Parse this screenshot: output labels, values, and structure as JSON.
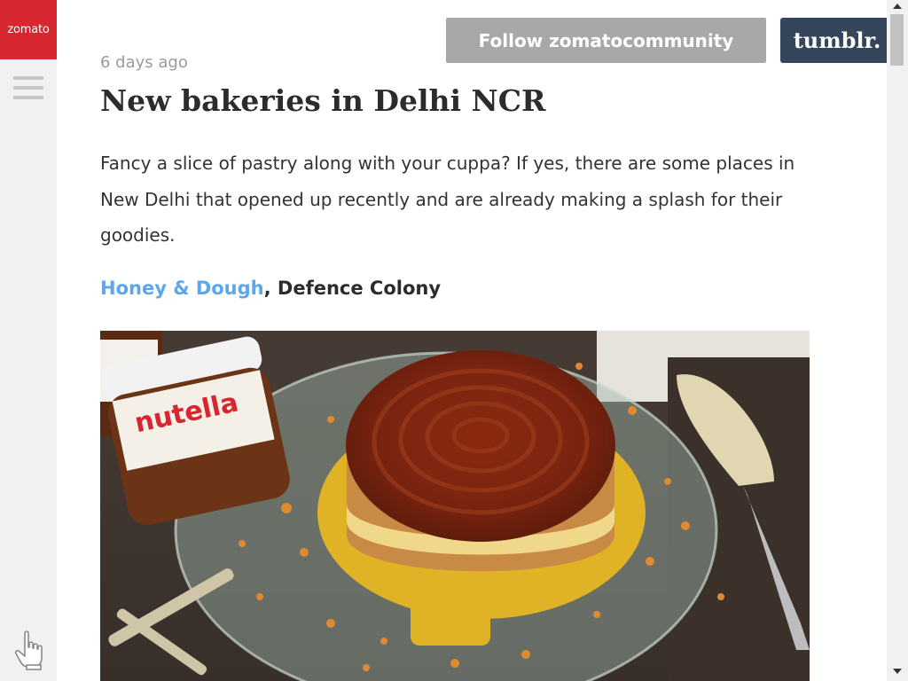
{
  "sidebar": {
    "logo_text": "zomato",
    "logo_color": "#d7262f",
    "menu_icon": "hamburger-menu-icon",
    "pointer_icon": "hand-pointer-icon"
  },
  "header": {
    "follow_label": "Follow zomatocommunity",
    "tumblr_label": "tumblr."
  },
  "post": {
    "timestamp": "6 days ago",
    "title": "New bakeries in Delhi NCR",
    "intro": "Fancy a slice of pastry along with your cuppa? If yes, there are some places in New Delhi that opened up recently and are already making a splash for their goodies.",
    "venue_link": "Honey & Dough",
    "venue_location": ", Defence Colony",
    "image_description": "cake-photo"
  },
  "colors": {
    "link": "#5aa7ee",
    "follow_button": "#a8a8a8",
    "tumblr_button": "#35465c"
  }
}
